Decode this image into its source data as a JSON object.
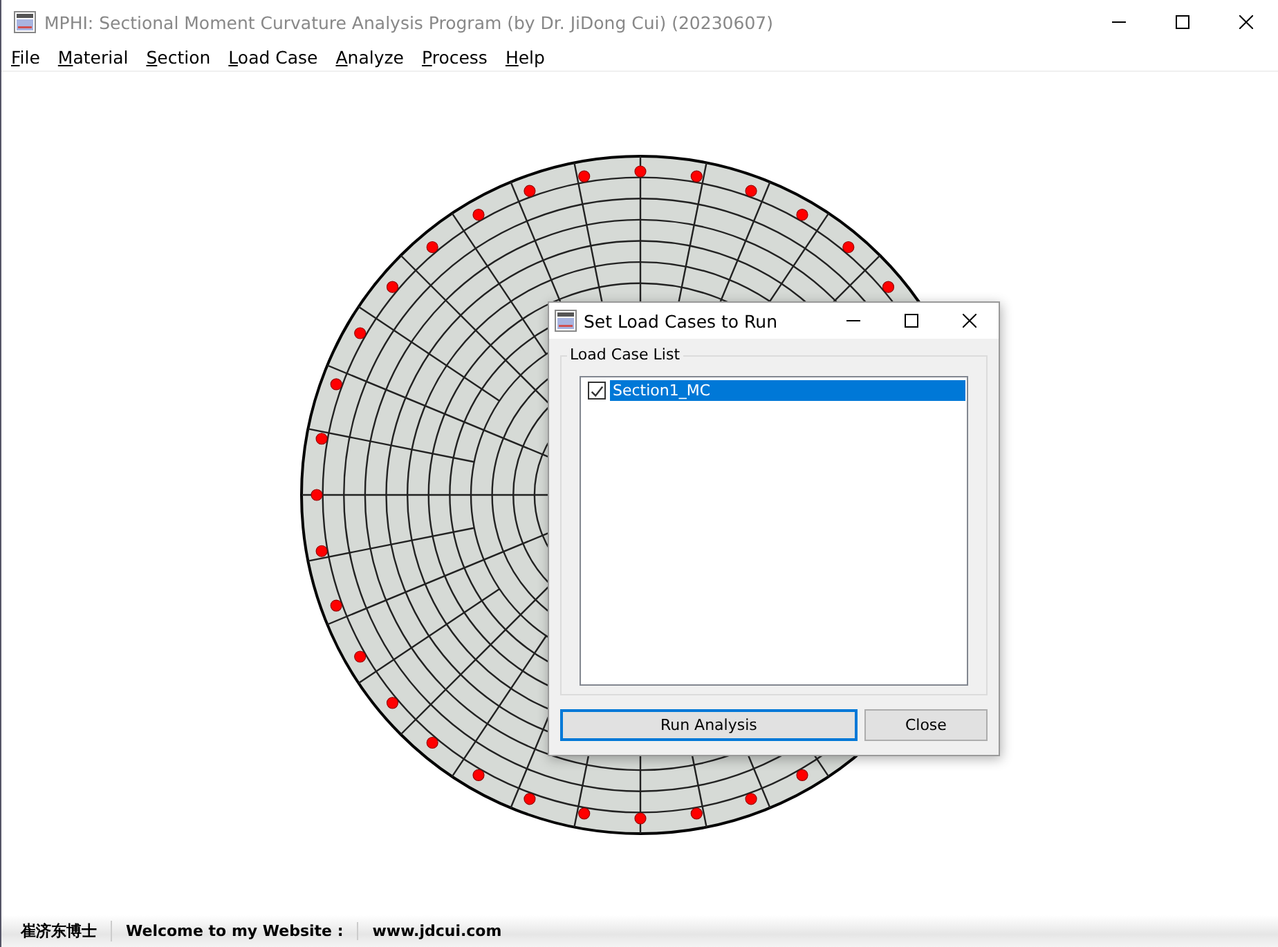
{
  "window": {
    "title": "MPHI: Sectional Moment Curvature Analysis Program (by Dr. JiDong Cui) (20230607)"
  },
  "menu": [
    {
      "label": "File"
    },
    {
      "label": "Material"
    },
    {
      "label": "Section"
    },
    {
      "label": "Load Case"
    },
    {
      "label": "Analyze"
    },
    {
      "label": "Process"
    },
    {
      "label": "Help"
    }
  ],
  "dialog": {
    "title": "Set Load Cases to Run",
    "group": {
      "label": "Load Case List",
      "items": [
        {
          "label": "Section1_MC",
          "checked": true,
          "selected": true
        }
      ]
    },
    "buttons": [
      {
        "label": "Run Analysis",
        "focused": true
      },
      {
        "label": "Close",
        "focused": false
      }
    ]
  },
  "status_bar": [
    {
      "text": "崔济东博士"
    },
    {
      "text": "Welcome to my Website :"
    },
    {
      "text": "www.jdcui.com"
    }
  ]
}
